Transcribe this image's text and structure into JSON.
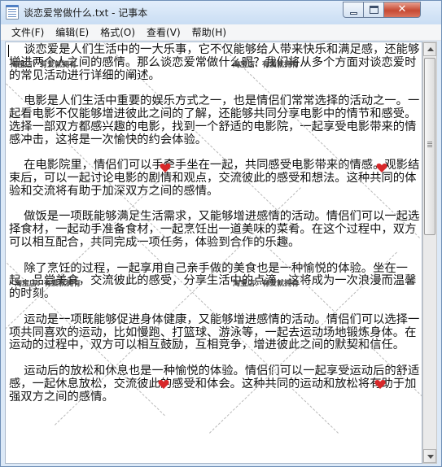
{
  "window": {
    "title": "谈恋爱常做什么.txt - 记事本",
    "close_glyph": "✕"
  },
  "menu": [
    {
      "label": "文件(F)"
    },
    {
      "label": "编辑(E)"
    },
    {
      "label": "格式(O)"
    },
    {
      "label": "查看(V)"
    },
    {
      "label": "帮助(H)"
    }
  ],
  "document": {
    "text": "    谈恋爱是人们生活中的一大乐事，它不仅能够给人带来快乐和满足感，还能够增进两个人之间的感情。那么谈恋爱常做什么呢？我们将从多个方面对谈恋爱时的常见活动进行详细的阐述。\n\n    电影是人们生活中重要的娱乐方式之一，也是情侣们常常选择的活动之一。一起看电影不仅能够增进彼此之间的了解，还能够共同分享电影中的情节和感受。选择一部双方都感兴趣的电影，找到一个舒适的电影院，一起享受电影带来的情感冲击，这将是一次愉快的约会体验。\n\n    在电影院里，情侣们可以手牵手坐在一起，共同感受电影带来的情感。观影结束后，可以一起讨论电影的剧情和观点，交流彼此的感受和想法。这种共同的体验和交流将有助于加深双方之间的感情。\n\n    做饭是一项既能够满足生活需求，又能够增进感情的活动。情侣们可以一起选择食材，一起动手准备食材，一起烹饪出一道美味的菜肴。在这个过程中，双方可以相互配合，共同完成一项任务，体验到合作的乐趣。\n\n    除了烹饪的过程，一起享用自己亲手做的美食也是一种愉悦的体验。坐在一起，品尝美食，交流彼此的感受，分享生活中的点滴，这将成为一次浪漫而温馨的时刻。\n\n    运动是一项既能够促进身体健康，又能够增进感情的活动。情侣们可以选择一项共同喜欢的运动，比如慢跑、打篮球、游泳等，一起去运动场地锻炼身体。在运动的过程中，双方可以相互鼓励，互相竞争，增进彼此之间的默契和信任。\n\n    运动后的放松和休息也是一种愉悦的体验。情侣们可以一起享受运动后的舒适感，一起休息放松，交流彼此的感受和体会。这种共同的运动和放松将有助于加强双方之间的感情。"
  },
  "watermark": {
    "text": "淘宝店：有爱就拥有",
    "color": "#444444"
  },
  "colors": {
    "titlebar": "#c9ddf3",
    "heart": "#d8282a",
    "close_button": "#c74a33"
  }
}
